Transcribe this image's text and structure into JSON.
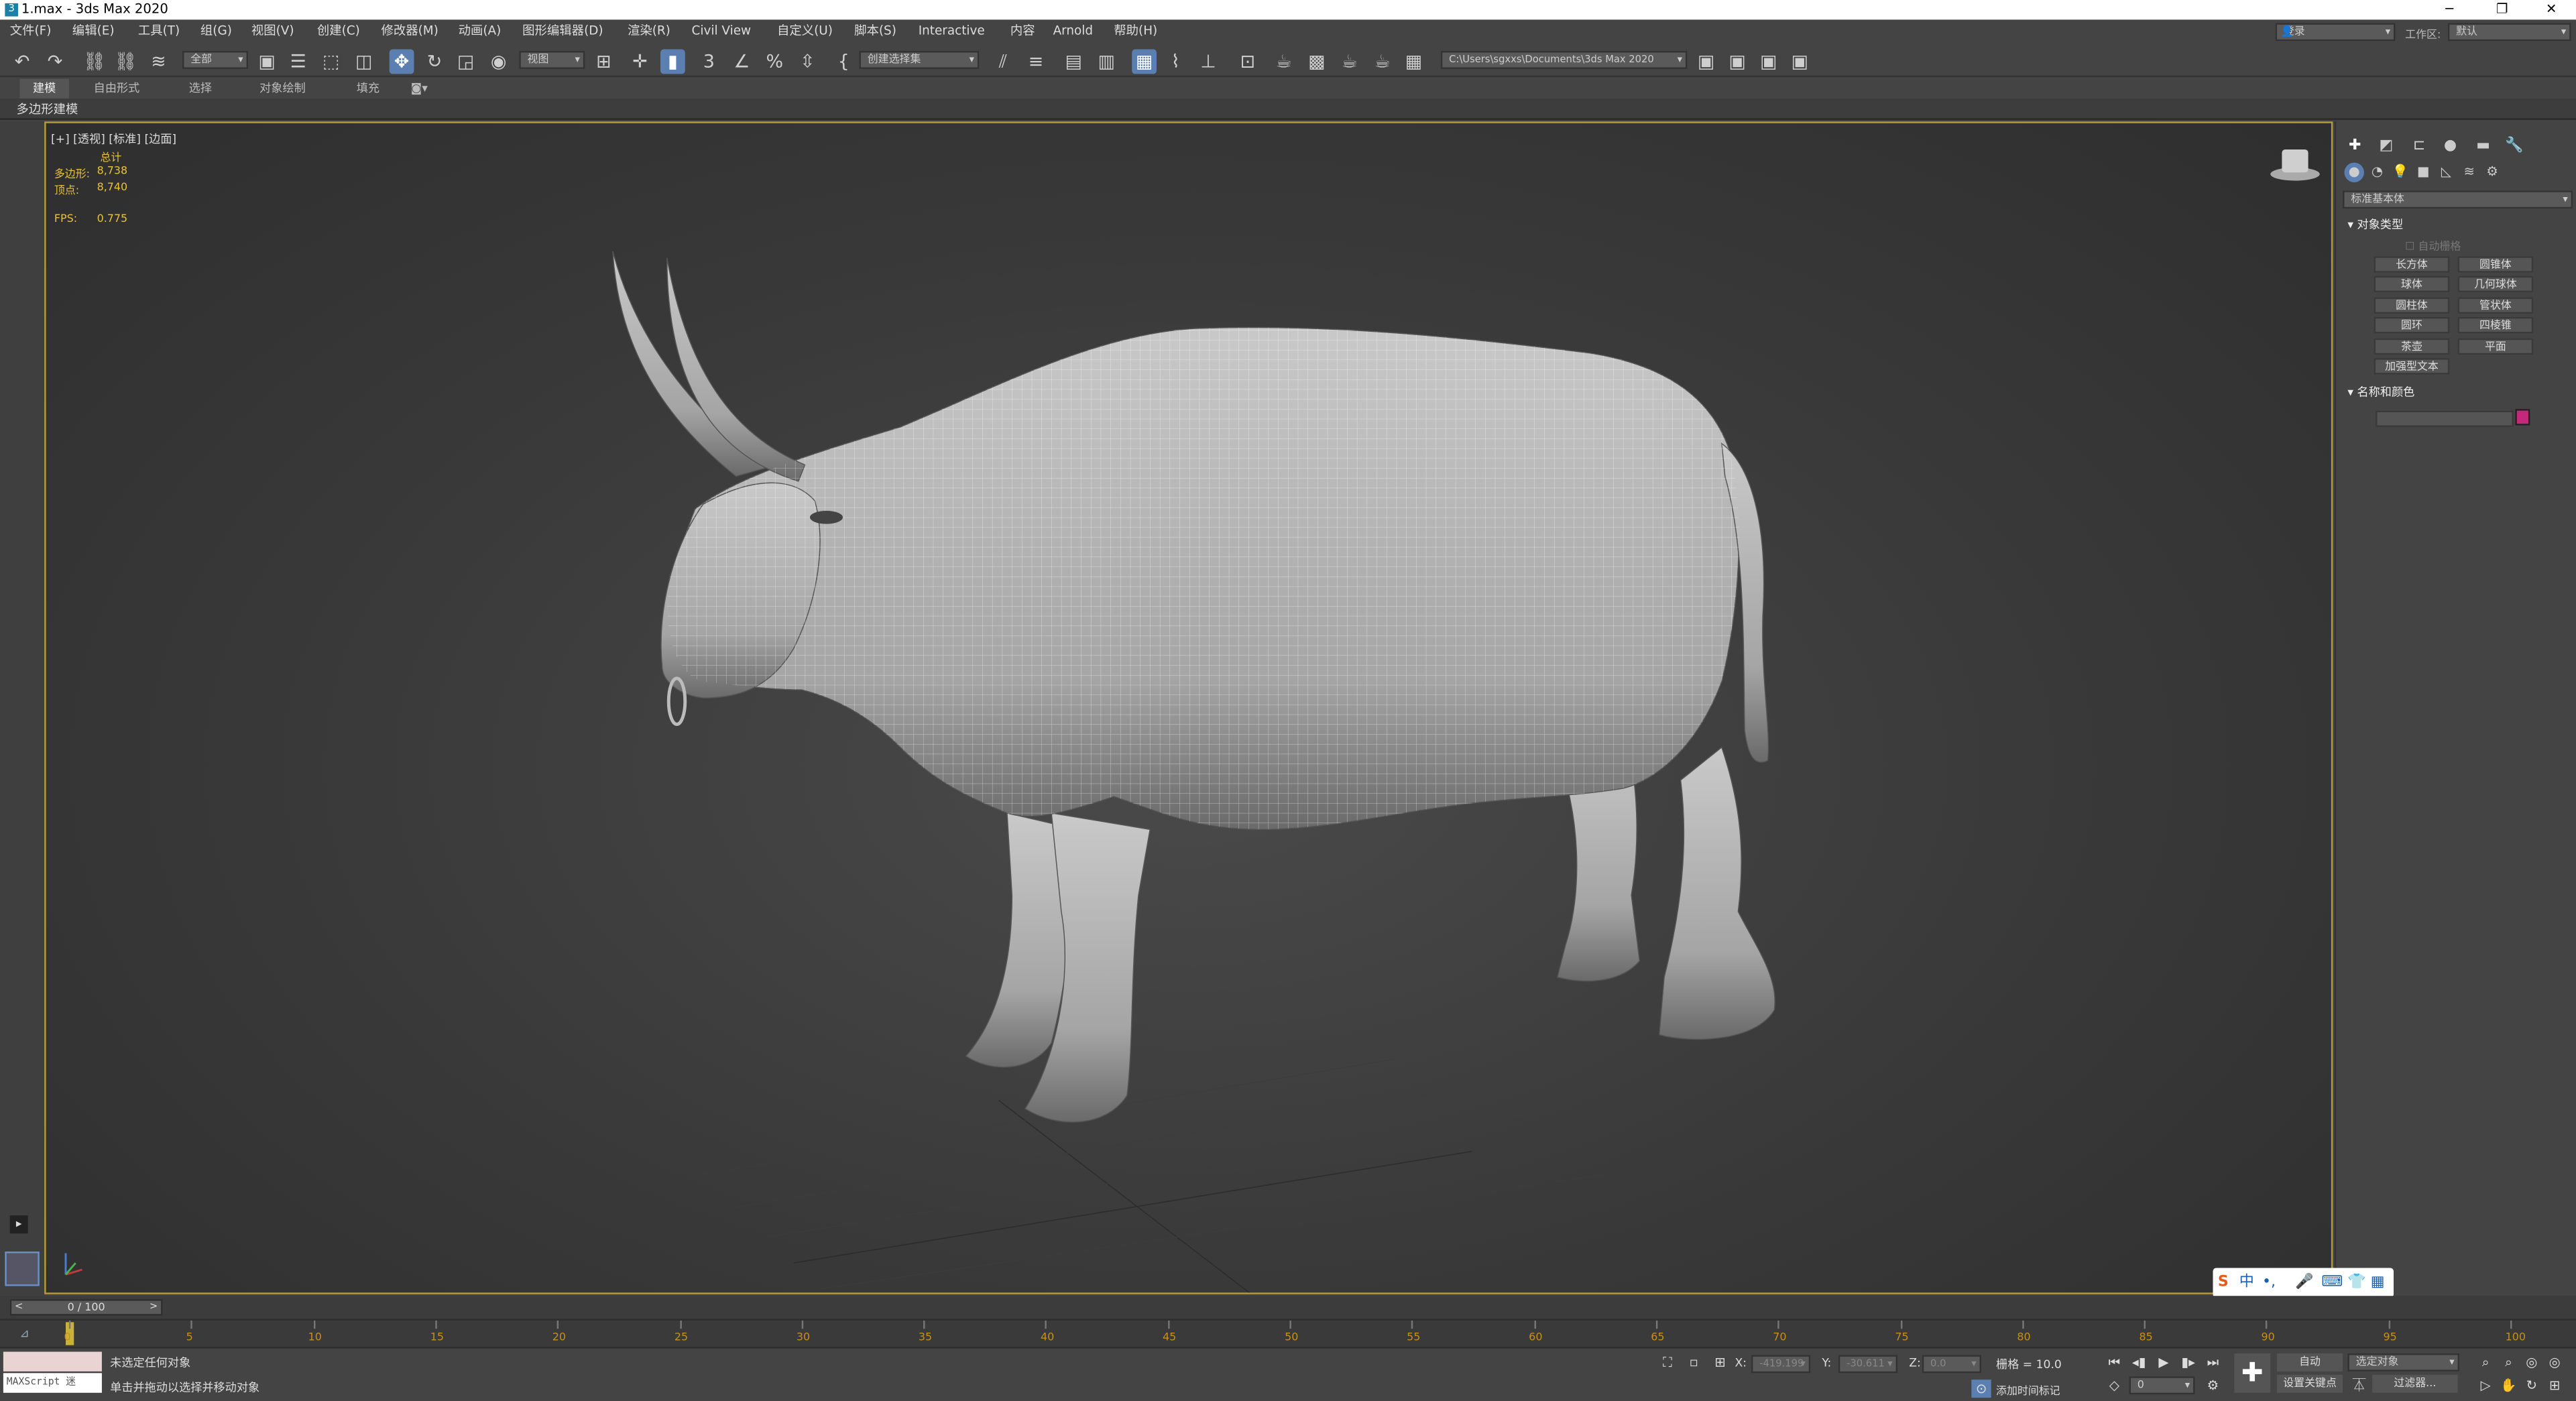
{
  "titlebar": {
    "title": "1.max - 3ds Max 2020",
    "minimize": "─",
    "restore": "❐",
    "close": "✕"
  },
  "menubar": {
    "items": [
      "文件(F)",
      "编辑(E)",
      "工具(T)",
      "组(G)",
      "视图(V)",
      "创建(C)",
      "修改器(M)",
      "动画(A)",
      "图形编辑器(D)",
      "渲染(R)",
      "Civil View",
      "自定义(U)",
      "脚本(S)",
      "Interactive",
      "内容",
      "Arnold",
      "帮助(H)"
    ],
    "login": "登录",
    "workspace_label": "工作区:",
    "workspace_value": "默认"
  },
  "toolbar": {
    "selection_filter": "全部",
    "ref_coord": "视图",
    "named_selection": "创建选择集",
    "project_path": "C:\\Users\\sgxxs\\Documents\\3ds Max 2020"
  },
  "ribbon": {
    "tabs": [
      "建模",
      "自由形式",
      "选择",
      "对象绘制",
      "填充"
    ],
    "active_panel": "多边形建模"
  },
  "viewport": {
    "label": "[+] [透视] [标准] [边面]",
    "stats_header": "总计",
    "polys_label": "多边形:",
    "polys_value": "8,738",
    "verts_label": "顶点:",
    "verts_value": "8,740",
    "fps_label": "FPS:",
    "fps_value": "0.775"
  },
  "command_panel": {
    "category": "标准基本体",
    "object_type_title": "对象类型",
    "autogrid": "自动栅格",
    "buttons": [
      "长方体",
      "圆锥体",
      "球体",
      "几何球体",
      "圆柱体",
      "管状体",
      "圆环",
      "四棱锥",
      "茶壶",
      "平面"
    ],
    "extra_button": "加强型文本",
    "name_color_title": "名称和颜色",
    "object_color": "#c2297a"
  },
  "timeline": {
    "frame_display": "0 / 100",
    "ticks": [
      "0",
      "5",
      "10",
      "15",
      "20",
      "25",
      "30",
      "35",
      "40",
      "45",
      "50",
      "55",
      "60",
      "65",
      "70",
      "75",
      "80",
      "85",
      "90",
      "95",
      "100"
    ]
  },
  "statusbar": {
    "maxscript": "MAXScript 迷",
    "status_line1": "未选定任何对象",
    "status_line2": "单击并拖动以选择并移动对象",
    "x_label": "X:",
    "x_value": "-419.199",
    "y_label": "Y:",
    "y_value": "-30.611",
    "z_label": "Z:",
    "z_value": "0.0",
    "grid": "栅格 = 10.0",
    "add_time_tag": "添加时间标记",
    "auto_key": "自动",
    "set_key": "设置关键点",
    "selected_object": "选定对象",
    "key_filters": "过滤器...",
    "frame": "0"
  },
  "ime": {
    "label": "中",
    "extras": "•,"
  }
}
